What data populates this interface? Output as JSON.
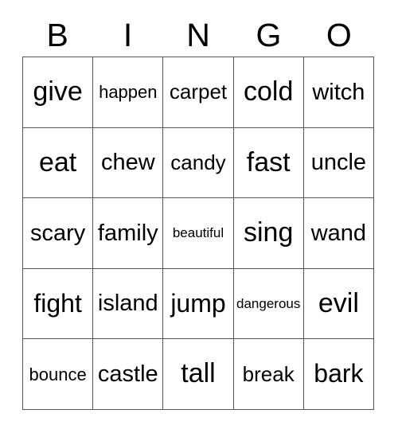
{
  "card": {
    "header_letters": [
      "B",
      "I",
      "N",
      "G",
      "O"
    ],
    "colors": {
      "background": "#ffffff",
      "text": "#000000",
      "grid_border": "#555555"
    },
    "grid": {
      "columns": 5,
      "rows": 5,
      "cells": [
        [
          {
            "word": "give",
            "size": "xl"
          },
          {
            "word": "happen",
            "size": "xs"
          },
          {
            "word": "carpet",
            "size": "sm"
          },
          {
            "word": "cold",
            "size": "xl"
          },
          {
            "word": "witch",
            "size": "md"
          }
        ],
        [
          {
            "word": "eat",
            "size": "xl"
          },
          {
            "word": "chew",
            "size": "md"
          },
          {
            "word": "candy",
            "size": "sm"
          },
          {
            "word": "fast",
            "size": "xl"
          },
          {
            "word": "uncle",
            "size": "md"
          }
        ],
        [
          {
            "word": "scary",
            "size": "md"
          },
          {
            "word": "family",
            "size": "md"
          },
          {
            "word": "beautiful",
            "size": "xxs"
          },
          {
            "word": "sing",
            "size": "xl"
          },
          {
            "word": "wand",
            "size": "md"
          }
        ],
        [
          {
            "word": "fight",
            "size": "lg"
          },
          {
            "word": "island",
            "size": "md"
          },
          {
            "word": "jump",
            "size": "lg"
          },
          {
            "word": "dangerous",
            "size": "xxs"
          },
          {
            "word": "evil",
            "size": "xl"
          }
        ],
        [
          {
            "word": "bounce",
            "size": "xs"
          },
          {
            "word": "castle",
            "size": "md"
          },
          {
            "word": "tall",
            "size": "xl"
          },
          {
            "word": "break",
            "size": "sm"
          },
          {
            "word": "bark",
            "size": "lg"
          }
        ]
      ]
    }
  }
}
